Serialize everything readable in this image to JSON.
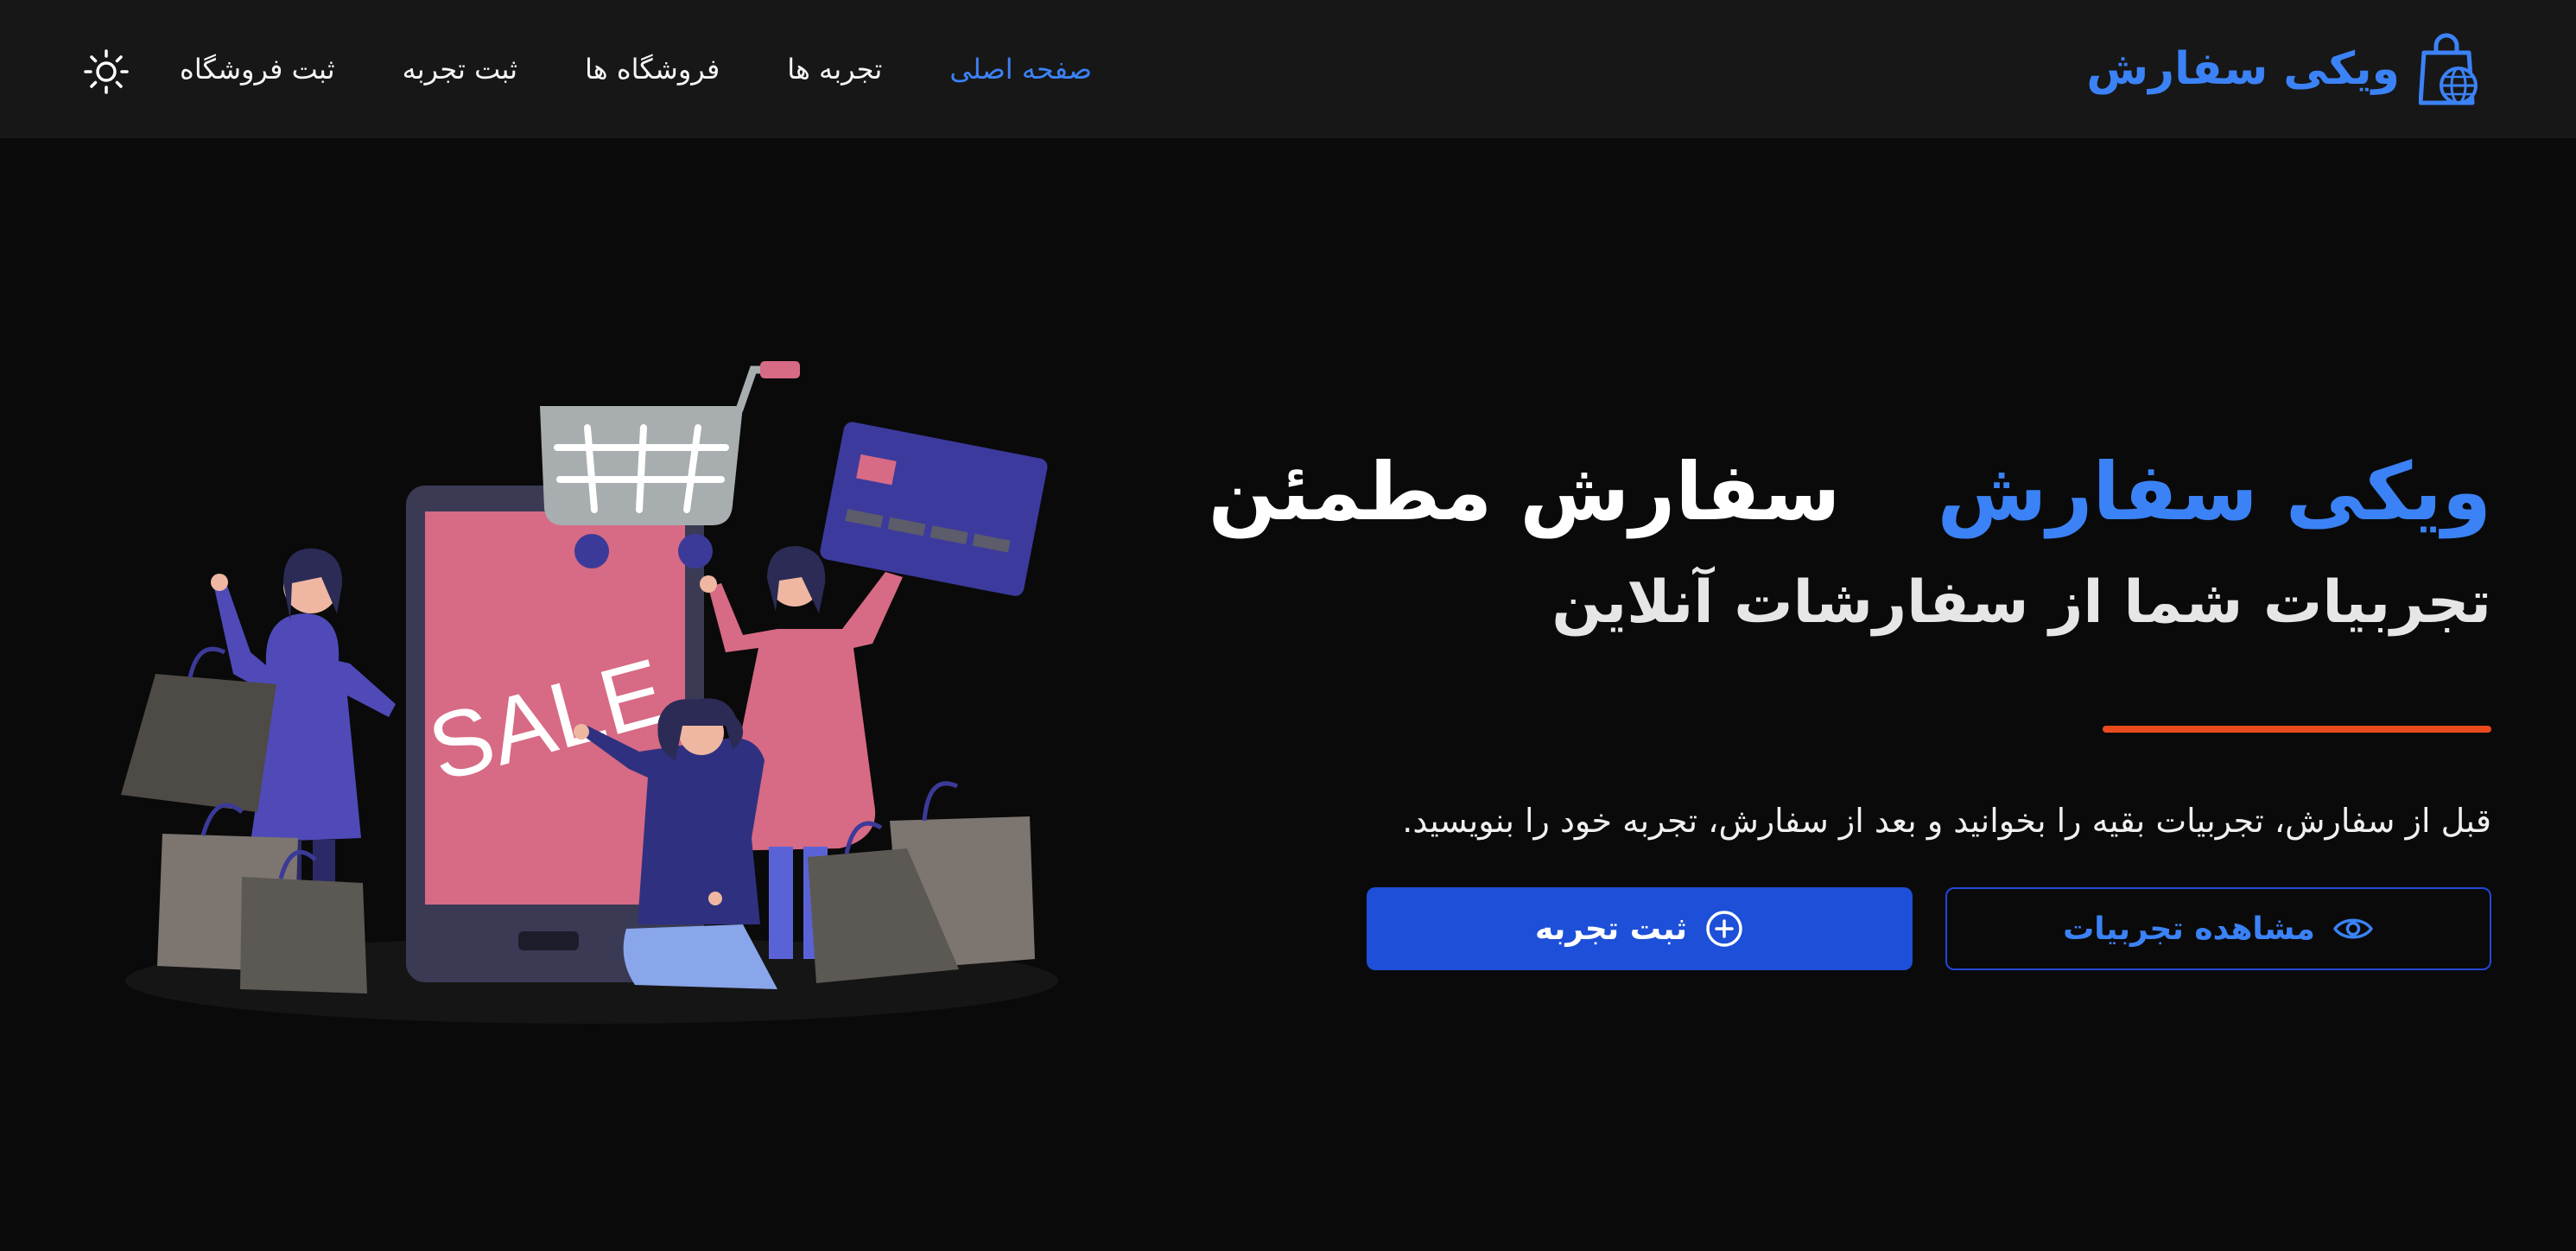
{
  "nav": {
    "brand_name": "ویکی سفارش",
    "links": [
      {
        "label": "صفحه اصلی",
        "active": true
      },
      {
        "label": "تجربه ها"
      },
      {
        "label": "فروشگاه ها"
      },
      {
        "label": "ثبت تجربه"
      },
      {
        "label": "ثبت فروشگاه"
      }
    ],
    "theme_toggle_icon": "sun-icon"
  },
  "hero": {
    "title_brand": "ویکی سفارش",
    "title_rest": "سفارش مطمئن",
    "subtitle": "تجربیات شما از سفارشات آنلاین",
    "description": "قبل از سفارش، تجربیات بقیه را بخوانید و بعد از سفارش، تجربه خود را بنویسید.",
    "btn_view": "مشاهده تجربیات",
    "btn_view_icon": "eye-icon",
    "btn_add": "ثبت تجربه",
    "btn_add_icon": "plus-circle-icon",
    "illustration_text": "SALE"
  },
  "colors": {
    "background": "#0a0a0a",
    "navbar": "#171717",
    "accent_blue": "#3b82f6",
    "primary_button": "#1d4fd8",
    "accent_line": "#ea4a1d"
  }
}
